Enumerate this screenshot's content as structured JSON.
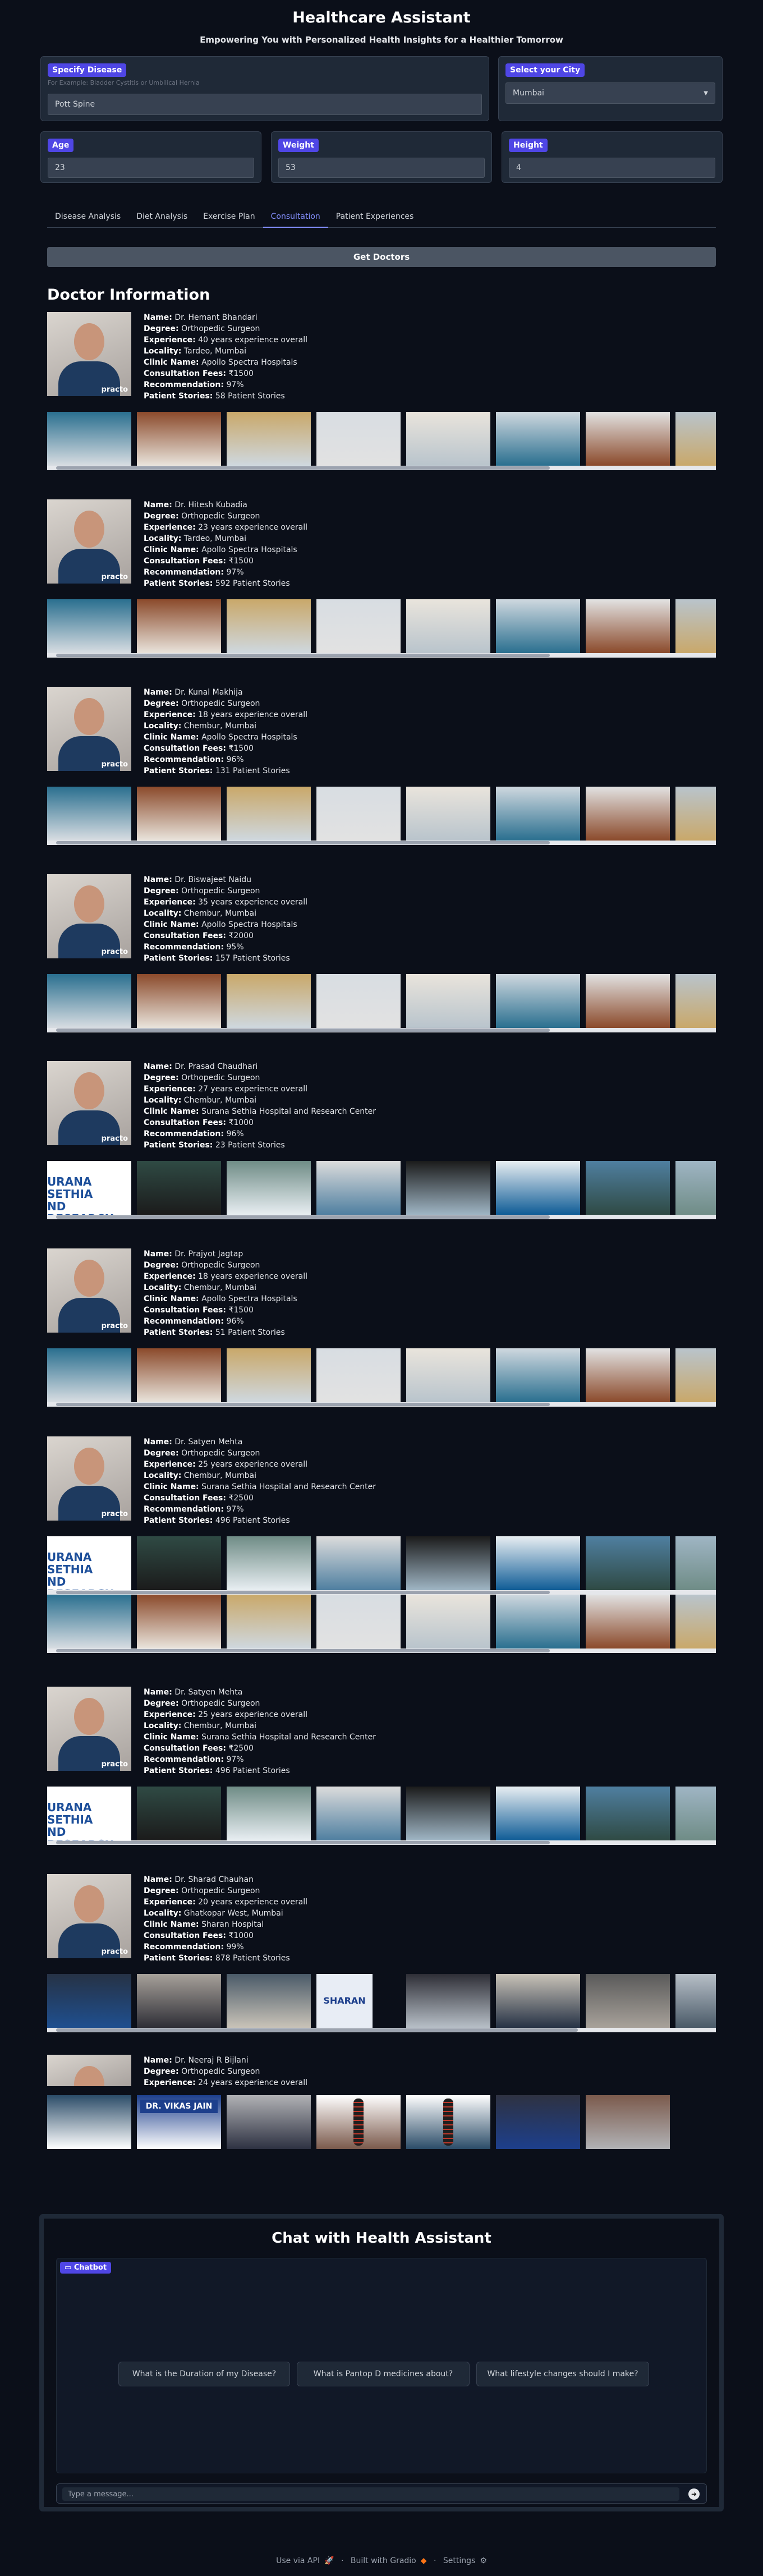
{
  "header": {
    "title": "Healthcare Assistant",
    "subtitle": "Empowering You with Personalized Health Insights for a Healthier Tomorrow"
  },
  "form": {
    "disease_label": "Specify Disease",
    "disease_info": "For Example: Bladder Cystitis or Umbilical Hernia",
    "disease_value": "Pott Spine",
    "city_label": "Select your City",
    "city_value": "Mumbai",
    "age_label": "Age",
    "age_value": "23",
    "weight_label": "Weight",
    "weight_value": "53",
    "height_label": "Height",
    "height_value": "4"
  },
  "tabs": [
    "Disease Analysis",
    "Diet Analysis",
    "Exercise Plan",
    "Consultation",
    "Patient Experiences"
  ],
  "active_tab": "Consultation",
  "get_doctors_label": "Get Doctors",
  "section_title": "Doctor Information",
  "field_labels": {
    "name": "Name:",
    "degree": "Degree:",
    "experience": "Experience:",
    "locality": "Locality:",
    "clinic": "Clinic Name:",
    "fees": "Consultation Fees:",
    "recommendation": "Recommendation:",
    "stories": "Patient Stories:"
  },
  "doctors": [
    {
      "name": "Dr. Hemant Bhandari",
      "degree": "Orthopedic Surgeon",
      "experience": "40 years experience overall",
      "locality": "Tardeo, Mumbai",
      "clinic": "Apollo Spectra Hospitals",
      "fees": "₹1500",
      "recommendation": "97%",
      "stories": "58 Patient Stories",
      "gallery": "apollo"
    },
    {
      "name": "Dr. Hitesh Kubadia",
      "degree": "Orthopedic Surgeon",
      "experience": "23 years experience overall",
      "locality": "Tardeo, Mumbai",
      "clinic": "Apollo Spectra Hospitals",
      "fees": "₹1500",
      "recommendation": "97%",
      "stories": "592 Patient Stories",
      "gallery": "apollo"
    },
    {
      "name": "Dr. Kunal Makhija",
      "degree": "Orthopedic Surgeon",
      "experience": "18 years experience overall",
      "locality": "Chembur, Mumbai",
      "clinic": "Apollo Spectra Hospitals",
      "fees": "₹1500",
      "recommendation": "96%",
      "stories": "131 Patient Stories",
      "gallery": "apollo"
    },
    {
      "name": "Dr. Biswajeet Naidu",
      "degree": "Orthopedic Surgeon",
      "experience": "35 years experience overall",
      "locality": "Chembur, Mumbai",
      "clinic": "Apollo Spectra Hospitals",
      "fees": "₹2000",
      "recommendation": "95%",
      "stories": "157 Patient Stories",
      "gallery": "apollo"
    },
    {
      "name": "Dr. Prasad Chaudhari",
      "degree": "Orthopedic Surgeon",
      "experience": "27 years experience overall",
      "locality": "Chembur, Mumbai",
      "clinic": "Surana Sethia Hospital and Research Center",
      "fees": "₹1000",
      "recommendation": "96%",
      "stories": "23 Patient Stories",
      "gallery": "surana"
    },
    {
      "name": "Dr. Prajyot Jagtap",
      "degree": "Orthopedic Surgeon",
      "experience": "18 years experience overall",
      "locality": "Chembur, Mumbai",
      "clinic": "Apollo Spectra Hospitals",
      "fees": "₹1500",
      "recommendation": "96%",
      "stories": "51 Patient Stories",
      "gallery": "apollo"
    },
    {
      "name": "Dr. Satyen Mehta",
      "degree": "Orthopedic Surgeon",
      "experience": "25 years experience overall",
      "locality": "Chembur, Mumbai",
      "clinic": "Surana Sethia Hospital and Research Center",
      "fees": "₹2500",
      "recommendation": "97%",
      "stories": "496 Patient Stories",
      "gallery": "surana2"
    },
    {
      "name": "Dr. Satyen Mehta",
      "degree": "Orthopedic Surgeon",
      "experience": "25 years experience overall",
      "locality": "Chembur, Mumbai",
      "clinic": "Surana Sethia Hospital and Research Center",
      "fees": "₹2500",
      "recommendation": "97%",
      "stories": "496 Patient Stories",
      "gallery": "surana"
    },
    {
      "name": "Dr. Sharad Chauhan",
      "degree": "Orthopedic Surgeon",
      "experience": "20 years experience overall",
      "locality": "Ghatkopar West, Mumbai",
      "clinic": "Sharan Hospital",
      "fees": "₹1000",
      "recommendation": "99%",
      "stories": "878 Patient Stories",
      "gallery": "sharan"
    },
    {
      "name": "Dr. Neeraj R Bijlani",
      "degree": "Orthopedic Surgeon",
      "experience": "24 years experience overall",
      "gallery": "bijlani"
    }
  ],
  "gallery_text": {
    "surana_sign_1": "URANA SETHIA",
    "surana_sign_2": "ND RESEARCH",
    "sharan_sign": "SHARAN",
    "jain_sign": "DR. VIKAS JAIN",
    "photo_watermark": "practo"
  },
  "chat": {
    "title": "Chat with Health Assistant",
    "badge": "Chatbot",
    "suggestions": [
      "What is the Duration of my Disease?",
      "What is Pantop D medicines about?",
      "What lifestyle changes should I make?"
    ],
    "input_placeholder": "Type a message...",
    "send_icon": "arrow-right-icon"
  },
  "footer": {
    "api": "Use via API",
    "built": "Built with Gradio",
    "settings": "Settings"
  }
}
